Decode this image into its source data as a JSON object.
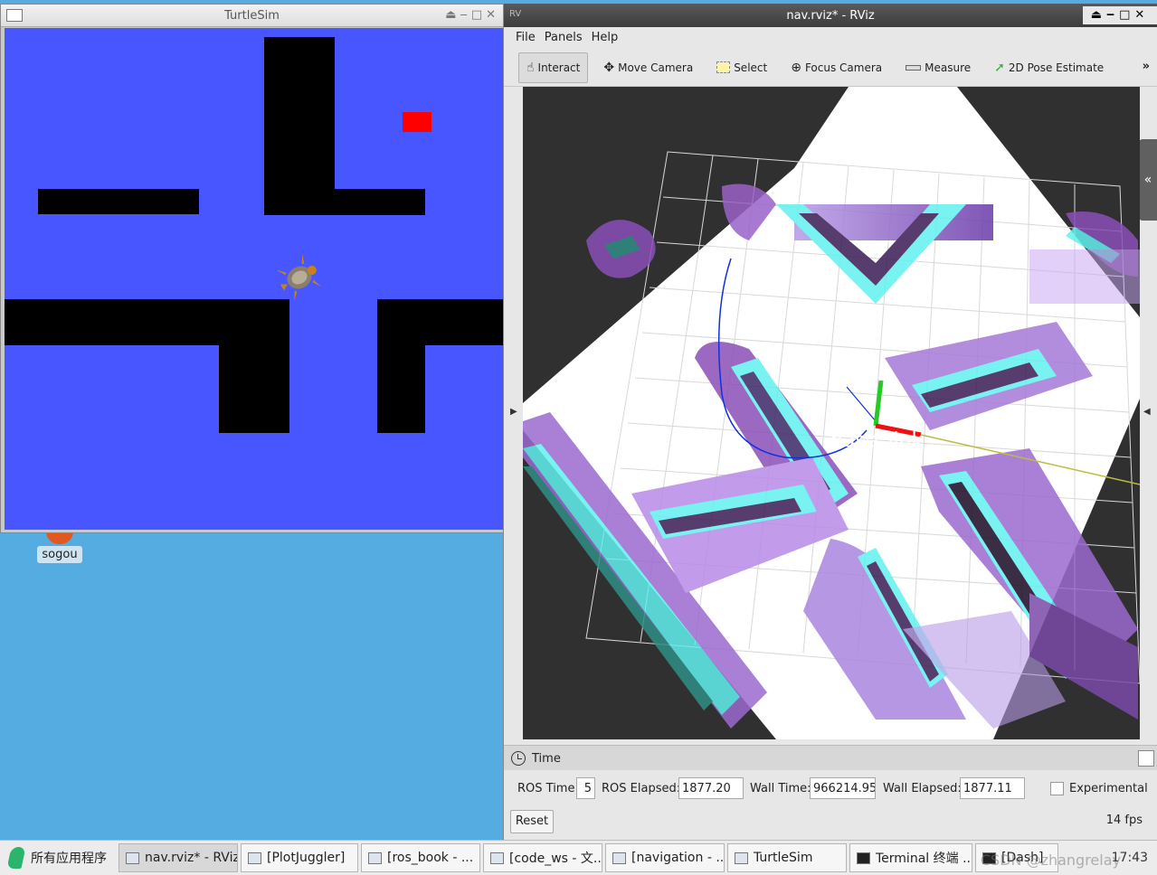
{
  "desktop": {
    "icon_label": "sogou"
  },
  "turtlesim": {
    "title": "TurtleSim"
  },
  "rviz": {
    "title": "nav.rviz* - RViz",
    "menu": [
      "File",
      "Panels",
      "Help"
    ],
    "tools": [
      "Interact",
      "Move Camera",
      "Select",
      "Focus Camera",
      "Measure",
      "2D Pose Estimate"
    ],
    "more": "»",
    "frame_label": "base_link",
    "time_panel": {
      "title": "Time",
      "ros_time_label": "ROS Time:",
      "ros_time_value": "5",
      "ros_elapsed_label": "ROS Elapsed:",
      "ros_elapsed_value": "1877.20",
      "wall_time_label": "Wall Time:",
      "wall_time_value": "966214.95",
      "wall_elapsed_label": "Wall Elapsed:",
      "wall_elapsed_value": "1877.11",
      "experimental_label": "Experimental",
      "reset_label": "Reset",
      "fps": "14 fps"
    }
  },
  "taskbar": {
    "start_label": "所有应用程序",
    "items": [
      "nav.rviz* - RViz",
      "[PlotJuggler]",
      "[ros_book - ...",
      "[code_ws - 文...",
      "[navigation - ...",
      "TurtleSim",
      "Terminal 终端 ...",
      "[Dash]"
    ],
    "clock": "17:43",
    "watermark": "CSDN @zhangrelay"
  }
}
